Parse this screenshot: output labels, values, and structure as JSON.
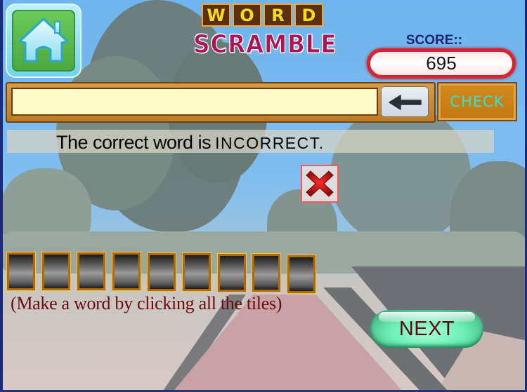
{
  "header": {
    "home_icon": "home-icon",
    "title_word_letters": [
      "W",
      "O",
      "R",
      "D"
    ],
    "title_subtitle": "SCRAMBLE"
  },
  "score": {
    "label": "SCORE::",
    "value": "695"
  },
  "answer": {
    "value": "",
    "placeholder": "",
    "backspace_icon": "left-arrow-icon",
    "check_label": "CHECK"
  },
  "feedback": {
    "prefix": "The correct word is",
    "word": "INCORRECT.",
    "result_icon": "red-x-icon"
  },
  "tiles": {
    "count": 9,
    "letters": [
      "",
      "",
      "",
      "",
      "",
      "",
      "",
      "",
      ""
    ],
    "hint": "(Make a word by clicking all the tiles)"
  },
  "next": {
    "label": "NEXT"
  },
  "colors": {
    "title_pink": "#b0125a",
    "title_tile_yellow": "#f8dc1a",
    "score_label": "#1c2478",
    "score_border": "#d8242f",
    "check_text": "#2ee2d8",
    "check_bg": "#d38a1d",
    "hint_text": "#6b0b0e",
    "next_text": "#5a0b14",
    "next_bg": "#6ff0b9"
  }
}
